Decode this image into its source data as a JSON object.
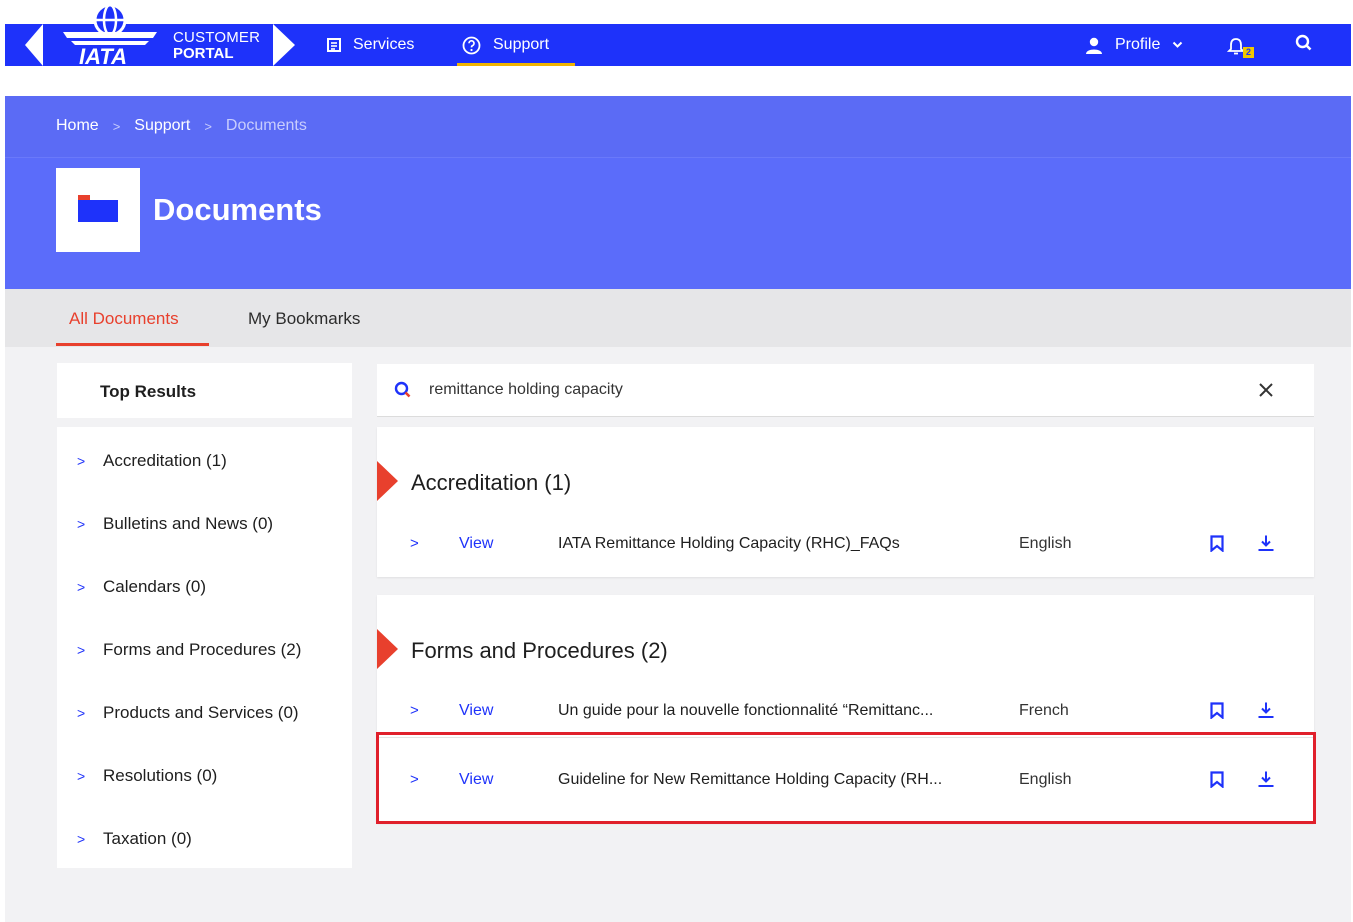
{
  "header": {
    "brand": {
      "logo_text": "IATA",
      "line1": "CUSTOMER",
      "line2": "PORTAL"
    },
    "nav": {
      "services_label": "Services",
      "support_label": "Support"
    },
    "profile_label": "Profile",
    "notification_count": "2",
    "colors": {
      "nav_bg": "#1e32fa",
      "accent": "#f0b400"
    }
  },
  "breadcrumbs": [
    "Home",
    "Support",
    "Documents"
  ],
  "breadcrumb_separator": ">",
  "page_title": "Documents",
  "tabs": {
    "all": "All Documents",
    "bookmarks": "My Bookmarks",
    "active": "All Documents"
  },
  "sidebar": {
    "heading": "Top Results",
    "items": [
      {
        "label": "Accreditation (1)"
      },
      {
        "label": "Bulletins and News (0)"
      },
      {
        "label": "Calendars (0)"
      },
      {
        "label": "Forms and Procedures (2)"
      },
      {
        "label": "Products and Services (0)"
      },
      {
        "label": "Resolutions (0)"
      },
      {
        "label": "Taxation (0)"
      }
    ]
  },
  "search": {
    "value": "remittance holding capacity",
    "clear_icon": "close-icon"
  },
  "results": [
    {
      "title": "Accreditation (1)",
      "rows": [
        {
          "view": "View",
          "name": "IATA Remittance Holding Capacity (RHC)_FAQs",
          "language": "English"
        }
      ]
    },
    {
      "title": "Forms and Procedures (2)",
      "rows": [
        {
          "view": "View",
          "name": "Un guide pour la nouvelle fonctionnalité “Remittanc...",
          "language": "French"
        },
        {
          "view": "View",
          "name": "Guideline for New Remittance Holding Capacity (RH...",
          "language": "English",
          "highlighted": true
        }
      ]
    }
  ],
  "colors": {
    "hero_bg": "#5b6cfa",
    "active_tab": "#e8402d",
    "link": "#1e32fa",
    "highlight_border": "#e0202b"
  }
}
